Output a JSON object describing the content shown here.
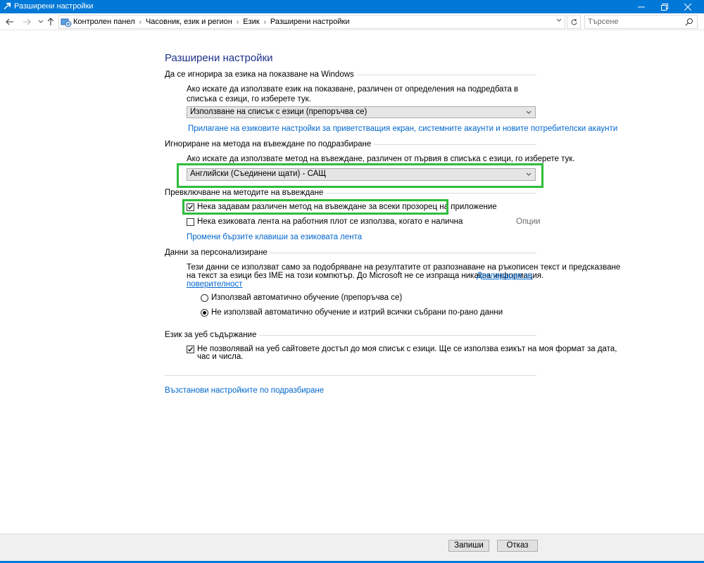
{
  "window": {
    "title": "Разширени настройки"
  },
  "nav": {
    "breadcrumbs": [
      "Контролен панел",
      "Часовник, език и регион",
      "Език",
      "Разширени настройки"
    ],
    "search_placeholder": "Търсене"
  },
  "page": {
    "title": "Разширени настройки"
  },
  "display_language": {
    "heading": "Да се игнорира за езика на показване на Windows",
    "description": "Ако искате да използвате език на показване, различен от определения на подредбата в списъка с езици, го изберете тук.",
    "selected": "Използване на списък с езици (препоръчва се)",
    "apply_link": "Прилагане на езиковите настройки за приветстващия екран, системните акаунти и новите потребителски акаунти"
  },
  "input_method": {
    "heading": "Игнориране на метода на въвеждане по подразбиране",
    "description": "Ако искате да използвате метод на въвеждане, различен от първия в списъка с езици, го изберете тук.",
    "selected": "Английски (Съединени щати) - САЩ"
  },
  "switching": {
    "heading": "Превключване на методите на въвеждане",
    "per_app_label": "Нека задавам различен метод на въвеждане за всеки прозорец на приложение",
    "per_app_checked": true,
    "desktop_bar_label": "Нека езиковата лента на работния плот се използва, когато е налична",
    "desktop_bar_checked": false,
    "options_link": "Опции",
    "hotkeys_link": "Промени бързите клавиши за езиковата лента"
  },
  "personalization": {
    "heading": "Данни за персонализиране",
    "description_line1": "Тези данни се използват само за подобряване на резултатите от разпознаване на ръкописен текст и предсказване",
    "description_line2": "на текст за езици без IME на този компютър. До Microsoft не се изпраща никаква информация.",
    "privacy_link_part1": "Декларация за",
    "privacy_link_part2": "поверителност",
    "option_use": "Използвай автоматично обучение (препоръчва се)",
    "option_dont_use": "Не използвай автоматично обучение и изтрий всички събрани по-рано данни",
    "selected_option": "dont_use"
  },
  "web_content": {
    "heading": "Език за уеб съдържание",
    "checkbox_label_line1": "Не позволявай на уеб сайтовете достъп до моя списък с езици. Ще се използва езикът на моя формат за дата,",
    "checkbox_label_line2": "час и числа.",
    "checked": true
  },
  "restore_link": "Възстанови настройките по подразбиране",
  "buttons": {
    "save": "Запиши",
    "cancel": "Отказ"
  },
  "colors": {
    "titlebar": "#0078d7",
    "link": "#0066cc",
    "page_title": "#1e3287",
    "highlight": "#2ebd3b"
  },
  "icons": [
    "settings-app-icon",
    "minimize-icon",
    "maximize-icon",
    "close-icon",
    "back-arrow-icon",
    "forward-arrow-icon",
    "up-arrow-icon",
    "control-panel-icon",
    "refresh-icon",
    "search-icon",
    "chevron-down-icon",
    "checkmark-icon"
  ]
}
